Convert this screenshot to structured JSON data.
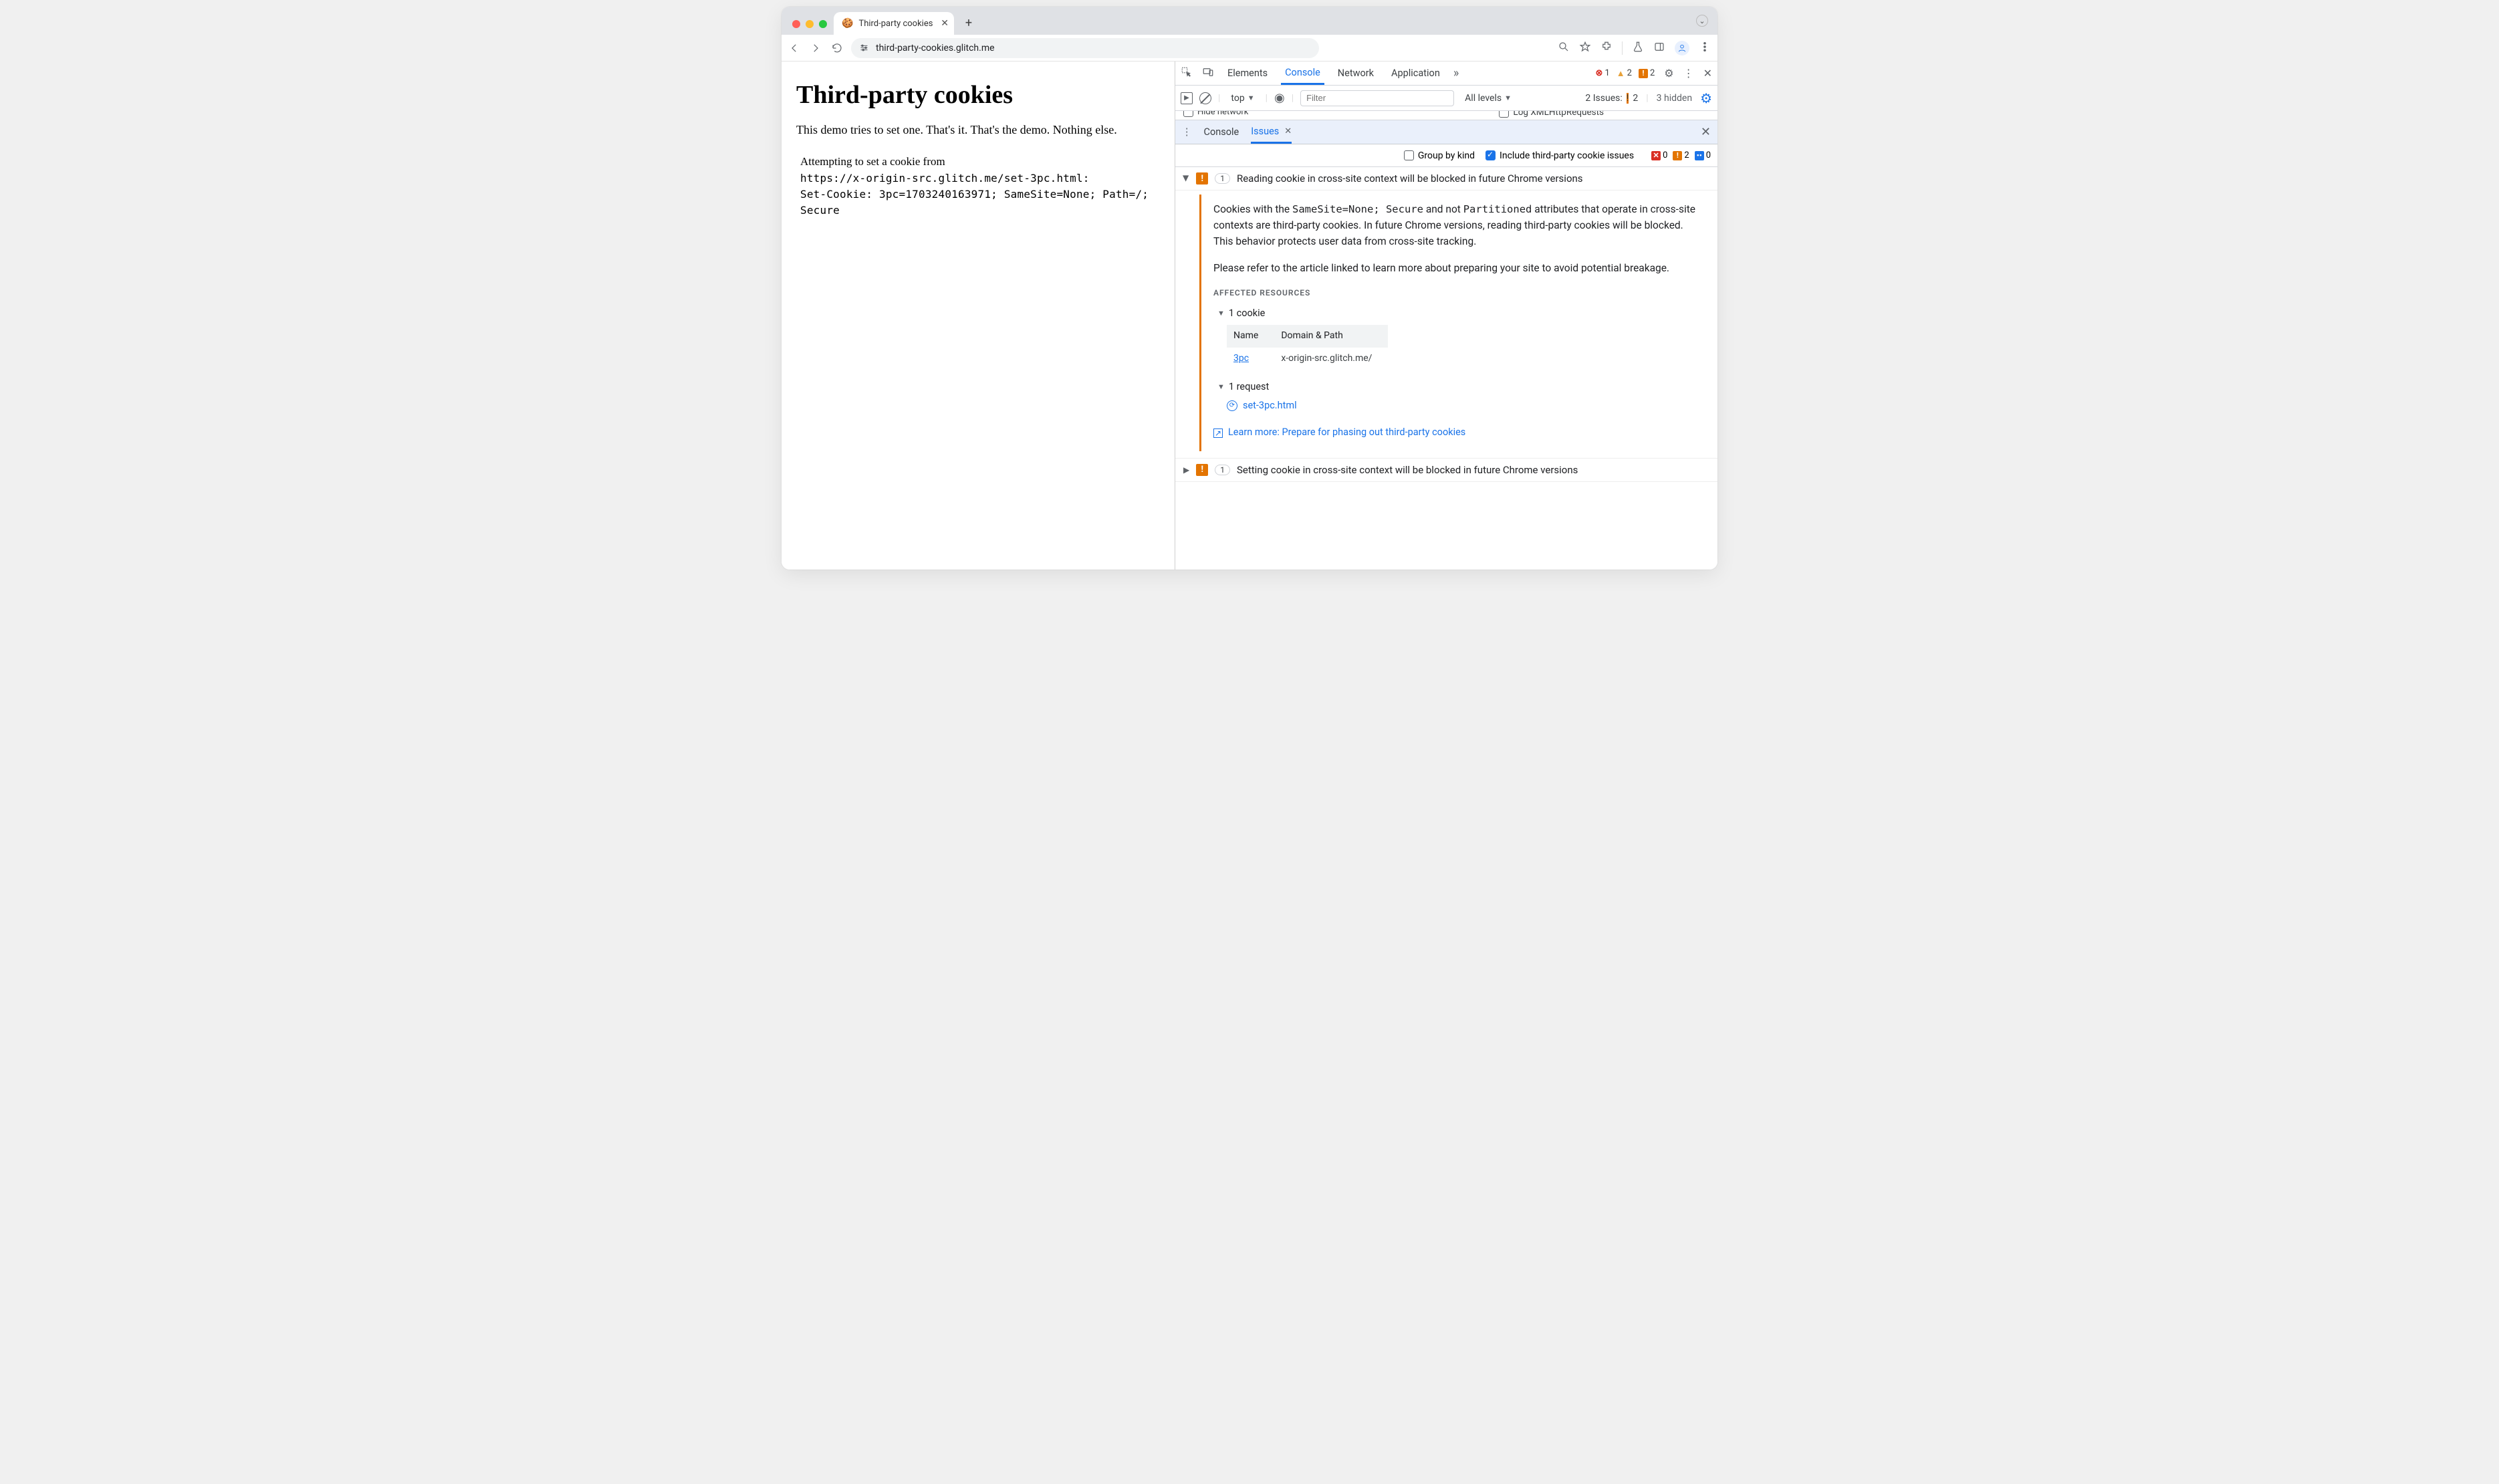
{
  "window": {
    "tab_title": "Third-party cookies",
    "url": "third-party-cookies.glitch.me"
  },
  "page": {
    "heading": "Third-party cookies",
    "intro": "This demo tries to set one. That's it. That's the demo. Nothing else.",
    "attempt_line": "Attempting to set a cookie from",
    "cookie_url": "https://x-origin-src.glitch.me/set-3pc.html:",
    "set_cookie": "Set-Cookie: 3pc=1703240163971; SameSite=None; Path=/; Secure"
  },
  "devtools": {
    "tabs": {
      "elements": "Elements",
      "console": "Console",
      "network": "Network",
      "application": "Application"
    },
    "status": {
      "errors": "1",
      "warnings": "2",
      "issues": "2"
    },
    "console_bar": {
      "context": "top",
      "filter_placeholder": "Filter",
      "levels": "All levels",
      "issues_text": "2 Issues:",
      "issues_badge": "2",
      "hidden": "3 hidden"
    },
    "peek": {
      "left": "Hide network",
      "right": "Log XMLHttpRequests"
    },
    "drawer": {
      "console_label": "Console",
      "issues_label": "Issues",
      "group_label": "Group by kind",
      "include_label": "Include third-party cookie issues",
      "counts": {
        "err": "0",
        "warn": "2",
        "info": "0"
      }
    },
    "issue1": {
      "count": "1",
      "title": "Reading cookie in cross-site context will be blocked in future Chrome versions",
      "body_pre": "Cookies with the ",
      "body_code1": "SameSite=None; Secure",
      "body_mid1": " and not ",
      "body_code2": "Partitioned",
      "body_post1": " attributes that operate in cross-site contexts are third-party cookies. In future Chrome versions, reading third-party cookies will be blocked. This behavior protects user data from cross-site tracking.",
      "body2": "Please refer to the article linked to learn more about preparing your site to avoid potential breakage.",
      "affected_label": "AFFECTED RESOURCES",
      "cookie_group": "1 cookie",
      "th_name": "Name",
      "th_domain": "Domain & Path",
      "td_name": "3pc",
      "td_domain": "x-origin-src.glitch.me/",
      "request_group": "1 request",
      "request_name": "set-3pc.html",
      "learn_more": "Learn more: Prepare for phasing out third-party cookies"
    },
    "issue2": {
      "count": "1",
      "title": "Setting cookie in cross-site context will be blocked in future Chrome versions"
    }
  }
}
